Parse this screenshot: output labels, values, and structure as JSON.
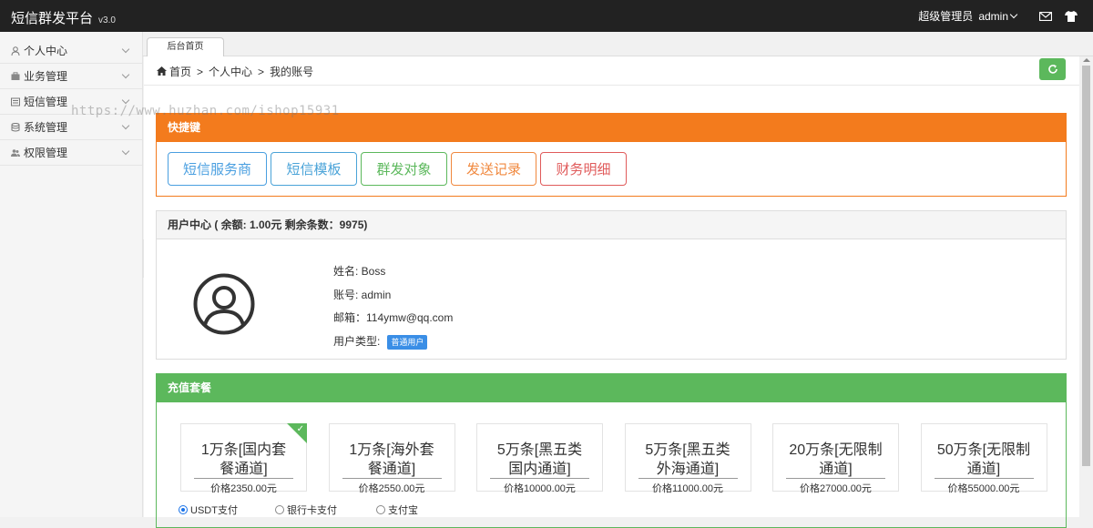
{
  "app": {
    "title": "短信群发平台",
    "version": "v3.0"
  },
  "topbar": {
    "role": "超级管理员",
    "user": "admin"
  },
  "sidebar": {
    "items": [
      {
        "label": "个人中心",
        "icon": "user-icon"
      },
      {
        "label": "业务管理",
        "icon": "briefcase-icon"
      },
      {
        "label": "短信管理",
        "icon": "message-icon"
      },
      {
        "label": "系统管理",
        "icon": "database-icon"
      },
      {
        "label": "权限管理",
        "icon": "users-icon"
      }
    ]
  },
  "watermark": "https://www.huzhan.com/ishop15931",
  "tab": {
    "label": "后台首页"
  },
  "breadcrumb": {
    "home": "首页",
    "sep1": ">",
    "parent": "个人中心",
    "sep2": ">",
    "current": "我的账号"
  },
  "quick": {
    "title": "快捷键",
    "buttons": [
      {
        "label": "短信服务商",
        "color": "#4a9fe0"
      },
      {
        "label": "短信模板",
        "color": "#4aa3d8"
      },
      {
        "label": "群发对象",
        "color": "#5cb85c"
      },
      {
        "label": "发送记录",
        "color": "#f0883e"
      },
      {
        "label": "财务明细",
        "color": "#e05b5b"
      }
    ]
  },
  "usercenter": {
    "title": "用户中心 ( 余额: 1.00元 剩余条数：9975)",
    "name_label": "姓名: Boss",
    "account_label": "账号: admin",
    "email_label": "邮箱：114ymw@qq.com",
    "type_label": "用户类型:",
    "type_badge": "普通用户"
  },
  "recharge": {
    "title": "充值套餐",
    "packages": [
      {
        "name": "1万条[国内套餐通道]",
        "price": "价格2350.00元",
        "selected": true
      },
      {
        "name": "1万条[海外套餐通道]",
        "price": "价格2550.00元",
        "selected": false
      },
      {
        "name": "5万条[黑五类国内通道]",
        "price": "价格10000.00元",
        "selected": false
      },
      {
        "name": "5万条[黑五类外海通道]",
        "price": "价格11000.00元",
        "selected": false
      },
      {
        "name": "20万条[无限制通道]",
        "price": "价格27000.00元",
        "selected": false
      },
      {
        "name": "50万条[无限制通道]",
        "price": "价格55000.00元",
        "selected": false
      }
    ],
    "payments": [
      {
        "label": "USDT支付",
        "selected": true
      },
      {
        "label": "银行卡支付",
        "selected": false
      },
      {
        "label": "支付宝",
        "selected": false
      }
    ]
  }
}
